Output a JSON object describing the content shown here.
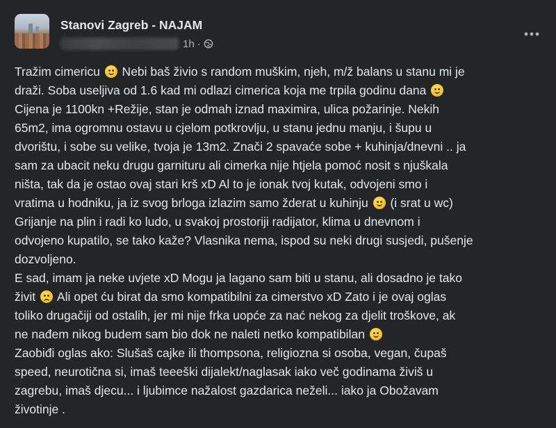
{
  "post": {
    "group_name": "Stanovi Zagreb - NAJAM",
    "time": "1h",
    "separator": "·",
    "lines": [
      [
        "Tražim cimericu ",
        {
          "emoji": "grin-sweat-emoji"
        },
        " Nebi baš živio s random muškim, njeh, m/ž balans u stanu mi je"
      ],
      [
        "draži. Soba useljiva od 1.6 kad mi odlazi cimerica koja me trpila godinu dana ",
        {
          "emoji": "relieved-emoji"
        }
      ],
      [
        "Cijena je 1100kn +Režije, stan je odmah iznad maximira, ulica požarinje. Nekih"
      ],
      [
        "65m2, ima ogromnu ostavu u cjelom potkrovlju, u stanu jednu manju, i šupu u"
      ],
      [
        "dvorištu, i sobe su velike, tvoja je 13m2. Znači 2 spavaće sobe + kuhinja/dnevni .. ja"
      ],
      [
        "sam za ubacit neku drugu garnituru ali cimerka nije htjela pomoć nosit s njuškala"
      ],
      [
        "ništa, tak da je ostao ovaj stari krš xD Al to je ionak tvoj kutak, odvojeni smo i"
      ],
      [
        "vratima u hodniku, ja iz svog brloga izlazim samo žderat u kuhinju ",
        {
          "emoji": "smirk-emoji"
        },
        "  (i srat u wc)"
      ],
      [
        "Grijanje na plin i radi ko ludo, u svakoj prostoriji radijator, klima u dnevnom i"
      ],
      [
        "odvojeno kupatilo, se tako kaže? Vlasnika nema, ispod su neki drugi susjedi, pušenje"
      ],
      [
        "dozvoljeno."
      ],
      [
        "E sad, imam ja neke uvjete xD Mogu ja lagano sam biti u stanu, ali dosadno je tako"
      ],
      [
        "živit ",
        {
          "emoji": "sad-emoji"
        },
        " Ali opet ću birat da smo kompatibilni za cimerstvo xD Zato i je ovaj oglas"
      ],
      [
        "toliko drugačiji od ostalih, jer mi nije frka uopće za nać nekog za djelit troškove, ak"
      ],
      [
        "ne nađem nikog budem sam bio dok ne naleti netko kompatibilan ",
        {
          "emoji": "smirk-emoji"
        }
      ],
      [
        "Zaobiđi oglas ako: Slušaš cajke ili thompsona, religiozna si osoba, vegan, čupaš"
      ],
      [
        "speed, neurotična si, imaš teeeški dijalekt/naglasak iako več godinama živiš u"
      ],
      [
        "zagrebu, imaš djecu... i ljubimce nažalost gazdarica neželi... iako ja Obožavam"
      ],
      [
        "životinje ."
      ]
    ]
  },
  "colors": {
    "background": "#242526",
    "text": "#e4e6eb",
    "secondary_text": "#b0b3b8"
  },
  "icons": {
    "privacy": "globe-icon",
    "menu": "more-options-icon"
  }
}
